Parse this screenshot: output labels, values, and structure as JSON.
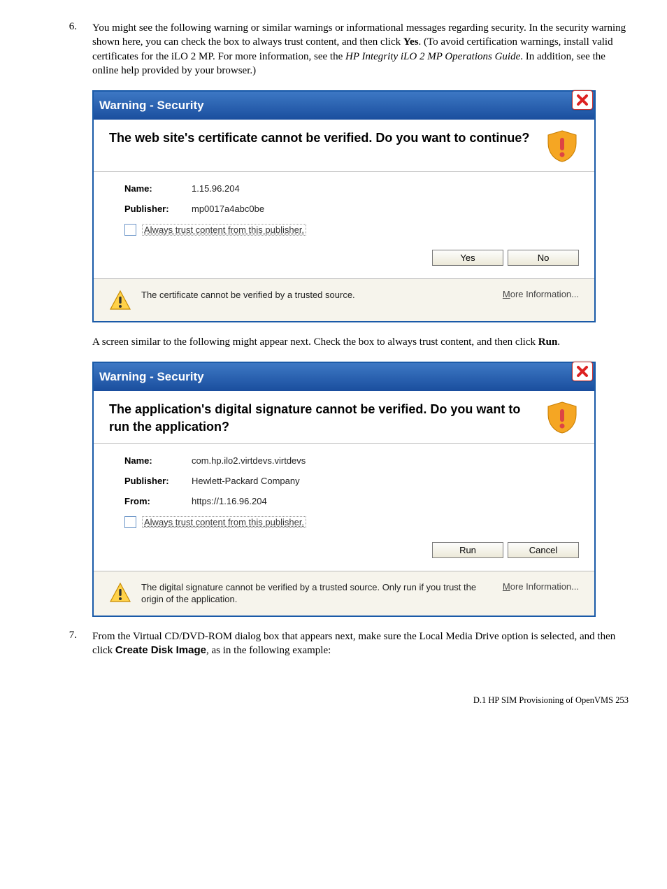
{
  "step6": {
    "num": "6.",
    "text_parts": {
      "p1": "You might see the following warning or similar warnings or informational messages regarding security. In the security warning shown here, you can check the box to always trust content, and then click ",
      "yes": "Yes",
      "p2": ". (To avoid certification warnings, install valid certificates for the iLO 2 MP. For more information, see the ",
      "guide": "HP Integrity iLO 2 MP Operations Guide",
      "p3": ". In addition, see the online help provided by your browser.)"
    },
    "between": {
      "p1": "A screen similar to the following might appear next. Check the box to always trust content, and then click ",
      "run": "Run",
      "p2": "."
    }
  },
  "dialog1": {
    "title": "Warning - Security",
    "headline": "The web site's certificate cannot be verified.  Do you want to continue?",
    "rows": {
      "name_label": "Name:",
      "name_value": "1.15.96.204",
      "pub_label": "Publisher:",
      "pub_value": "mp0017a4abc0be"
    },
    "checkbox": "Always trust content from this publisher.",
    "buttons": {
      "yes": "Yes",
      "no": "No"
    },
    "footer": "The certificate cannot be verified by a trusted source.",
    "more": "More Information..."
  },
  "dialog2": {
    "title": "Warning - Security",
    "headline": "The application's digital signature cannot be verified.  Do you want to run the application?",
    "rows": {
      "name_label": "Name:",
      "name_value": "com.hp.ilo2.virtdevs.virtdevs",
      "pub_label": "Publisher:",
      "pub_value": "Hewlett-Packard Company",
      "from_label": "From:",
      "from_value": "https://1.16.96.204"
    },
    "checkbox": "Always trust content from this publisher.",
    "buttons": {
      "run": "Run",
      "cancel": "Cancel"
    },
    "footer": "The digital signature cannot be verified by a trusted source.  Only run if you trust the origin of the application.",
    "more": "More Information..."
  },
  "step7": {
    "num": "7.",
    "text_parts": {
      "p1": "From the Virtual CD/DVD-ROM dialog box that appears next, make sure the Local Media Drive option is selected, and then click ",
      "btn": "Create Disk Image",
      "p2": ", as in the following example:"
    }
  },
  "footer_text": "D.1 HP SIM Provisioning of OpenVMS    253"
}
